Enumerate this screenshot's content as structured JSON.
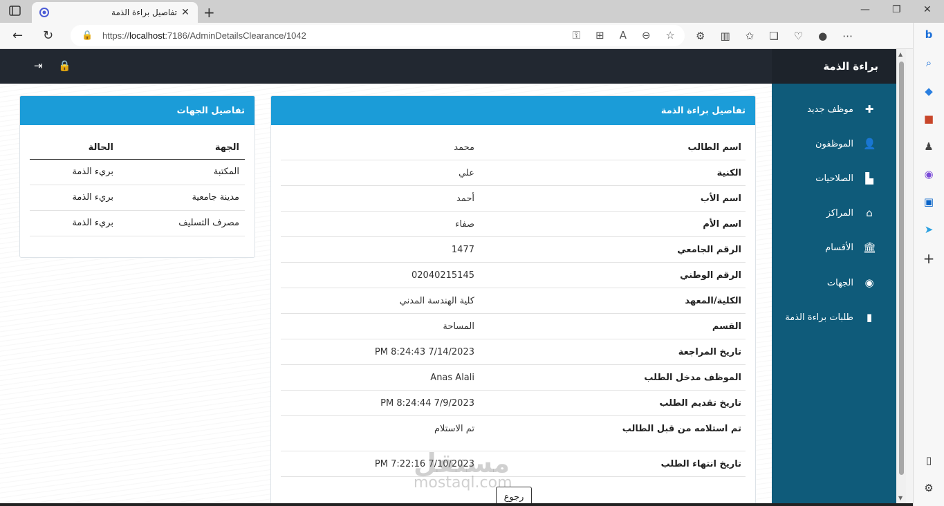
{
  "browser": {
    "tab_title": "تفاصيل براءة الذمة",
    "tab_close": "✕",
    "new_tab": "+",
    "url_prefix": "https://",
    "url_host": "localhost",
    "url_path": ":7186/AdminDetailsClearance/1042"
  },
  "app": {
    "brand": "براءة الذمة",
    "sidebar": [
      {
        "label": "موظف جديد",
        "icon": "plus-icon"
      },
      {
        "label": "الموظفون",
        "icon": "user-icon"
      },
      {
        "label": "الصلاحيات",
        "icon": "file-icon"
      },
      {
        "label": "المراكز",
        "icon": "home-icon"
      },
      {
        "label": "الأقسام",
        "icon": "bank-icon"
      },
      {
        "label": "الجهات",
        "icon": "eye-icon"
      },
      {
        "label": "طلبات براءة الذمة",
        "icon": "bookmark-icon"
      }
    ]
  },
  "details": {
    "title": "تفاصيل براءة الذمة",
    "rows": [
      {
        "key": "اسم الطالب",
        "value": "محمد"
      },
      {
        "key": "الكنية",
        "value": "علي"
      },
      {
        "key": "اسم الأب",
        "value": "أحمد"
      },
      {
        "key": "اسم الأم",
        "value": "صفاء"
      },
      {
        "key": "الرقم الجامعي",
        "value": "1477"
      },
      {
        "key": "الرقم الوطني",
        "value": "02040215145"
      },
      {
        "key": "الكلية/المعهد",
        "value": "كلية الهندسة المدني"
      },
      {
        "key": "القسم",
        "value": "المساحة"
      },
      {
        "key": "تاريخ المراجعة",
        "value": "7/14/2023 8:24:43 PM"
      },
      {
        "key": "الموظف مدخل الطلب",
        "value": "Anas Alali"
      },
      {
        "key": "تاريخ تقديم الطلب",
        "value": "7/9/2023 8:24:44 PM"
      },
      {
        "key": "تم استلامه من قبل الطالب",
        "value": "تم الاستلام"
      },
      {
        "key": "تاريخ انتهاء الطلب",
        "value": "7/10/2023 7:22:16 PM"
      }
    ],
    "back_label": "رجوع"
  },
  "bodies": {
    "title": "تفاصيل الجهات",
    "col_body": "الجهة",
    "col_status": "الحالة",
    "rows": [
      {
        "body": "المكتبة",
        "status": "بريء الذمة"
      },
      {
        "body": "مدينة جامعية",
        "status": "بريء الذمة"
      },
      {
        "body": "مصرف التسليف",
        "status": "بريء الذمة"
      }
    ]
  },
  "watermark": {
    "arabic": "مستقل",
    "latin": "mostaql.com"
  }
}
